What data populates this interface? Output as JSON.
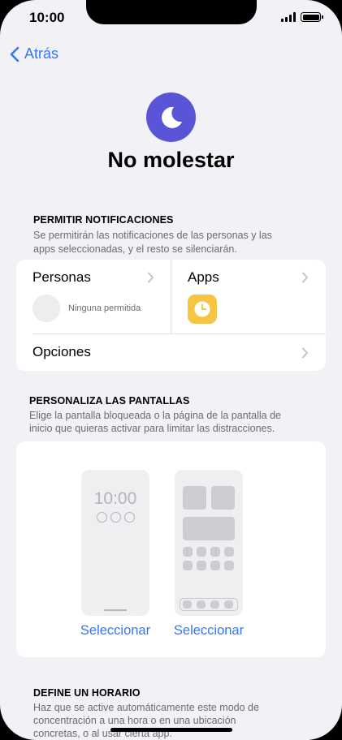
{
  "status": {
    "time": "10:00"
  },
  "nav": {
    "back_label": "Atrás"
  },
  "header": {
    "title": "No molestar"
  },
  "notifications": {
    "header": "PERMITIR NOTIFICACIONES",
    "desc_line1": "Se permitirán las notificaciones de las personas y las",
    "desc_line2": "apps seleccionadas, y el resto se silenciarán.",
    "people_label": "Personas",
    "people_none": "Ninguna permitida",
    "apps_label": "Apps",
    "options_label": "Opciones"
  },
  "screens": {
    "header": "PERSONALIZA LAS PANTALLAS",
    "desc_line1": "Elige la pantalla bloqueada o la página de la pantalla de",
    "desc_line2": "inicio que quieras activar para limitar las distracciones.",
    "lock_time": "10:00",
    "select_lock": "Seleccionar",
    "select_home": "Seleccionar"
  },
  "schedule": {
    "header": "DEFINE UN HORARIO",
    "desc_line1": "Haz que se active automáticamente este modo de",
    "desc_line2": "concentración a una hora o en una ubicación",
    "desc_line3": "concretas, o al usar cierta app."
  },
  "icons": [
    "moon-icon",
    "chevron-left-icon",
    "chevron-right-icon",
    "clock-app-icon",
    "signal-icon",
    "battery-icon"
  ],
  "colors": {
    "accent": "#3478f6",
    "focus_purple": "#5a55d6",
    "clock_yellow": "#f6c544"
  }
}
